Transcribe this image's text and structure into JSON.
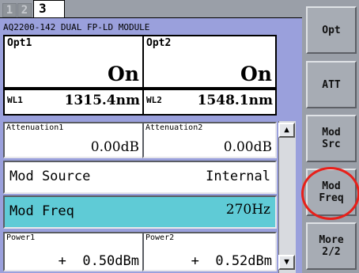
{
  "tabs": [
    "1",
    "2",
    "3"
  ],
  "module_title": "AQ2200-142 DUAL FP-LD MODULE",
  "opt1": {
    "label": "Opt1",
    "value": "On"
  },
  "opt2": {
    "label": "Opt2",
    "value": "On"
  },
  "wl1": {
    "label": "WL1",
    "value": "1315.4nm"
  },
  "wl2": {
    "label": "WL2",
    "value": "1548.1nm"
  },
  "att1": {
    "label": "Attenuation1",
    "value": "0.00dB"
  },
  "att2": {
    "label": "Attenuation2",
    "value": "0.00dB"
  },
  "mod_source": {
    "label": "Mod Source",
    "value": "Internal"
  },
  "mod_freq": {
    "label": "Mod Freq",
    "value": "270Hz",
    "highlight_color": "#5fcbd6"
  },
  "power1": {
    "label": "Power1",
    "sign": "+",
    "value": "0.50dBm"
  },
  "power2": {
    "label": "Power2",
    "sign": "+",
    "value": "0.52dBm"
  },
  "softkeys": [
    "Opt",
    "ATT",
    "Mod\nSrc",
    "Mod\nFreq",
    "More\n2/2"
  ],
  "highlight_ring_color": "#e8201a",
  "scroll_icons": {
    "up": "up-arrow-icon",
    "down": "down-arrow-icon"
  }
}
